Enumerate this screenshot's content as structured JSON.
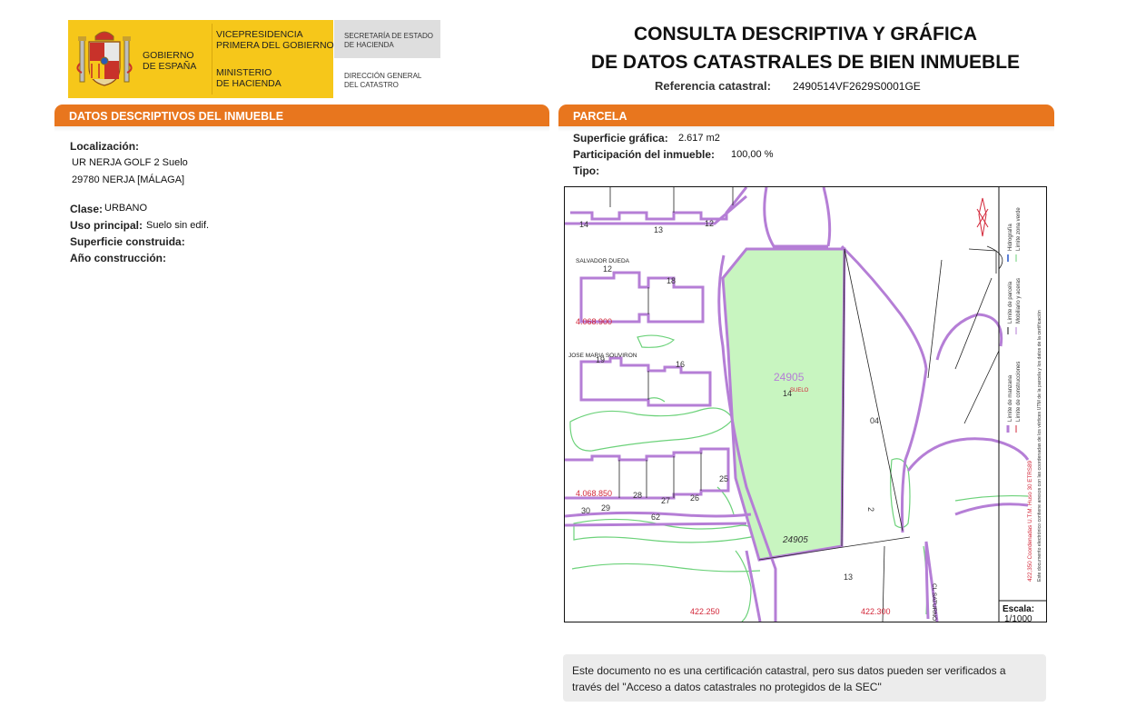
{
  "header": {
    "gobierno": [
      "GOBIERNO",
      "DE ESPAÑA"
    ],
    "vicepresidencia": [
      "VICEPRESIDENCIA",
      "PRIMERA DEL GOBIERNO"
    ],
    "ministerio": [
      "MINISTERIO",
      "DE HACIENDA"
    ],
    "secretaria": [
      "SECRETARÍA DE ESTADO",
      "DE HACIENDA"
    ],
    "direccion": [
      "DIRECCIÓN GENERAL",
      "DEL CATASTRO"
    ],
    "title_line1": "CONSULTA DESCRIPTIVA Y GRÁFICA",
    "title_line2": "DE DATOS CATASTRALES DE BIEN INMUEBLE",
    "refcat_label": "Referencia catastral:",
    "refcat_value": "2490514VF2629S0001GE",
    "colors": {
      "gov_yellow": "#f6c71a",
      "accent_orange": "#e8761e"
    }
  },
  "left_section": {
    "title": "DATOS DESCRIPTIVOS DEL INMUEBLE",
    "localizacion_label": "Localización:",
    "localizacion_line1": "UR NERJA GOLF 2 Suelo",
    "localizacion_line2": "29780 NERJA [MÁLAGA]",
    "clase_label": "Clase:",
    "clase_value": "URBANO",
    "uso_label": "Uso principal:",
    "uso_value": "Suelo sin edif.",
    "superficie_label": "Superficie construida:",
    "ano_label": "Año construcción:"
  },
  "right_section": {
    "title": "PARCELA",
    "superficie_label": "Superficie gráfica:",
    "superficie_value": "2.617 m2",
    "participacion_label": "Participación del inmueble:",
    "participacion_value": "100,00 %",
    "tipo_label": "Tipo:"
  },
  "map": {
    "parcel_id": "24905",
    "parcel_id_bottom": "24905",
    "parcel_number": "14",
    "suelo_label": "SUELO",
    "street1": "SALVADOR DUEDA",
    "street2": "JOSE MARIA SOUVIRON",
    "street3": "CL SATURNO",
    "coord_y1": "4.068.900",
    "coord_y2": "4.068.850",
    "coord_x1": "422.250",
    "coord_x2": "422.300",
    "numbers": {
      "n14a": "14",
      "n13a": "13",
      "n12a": "12",
      "n12b": "12",
      "n18": "18",
      "n19": "19",
      "n16": "16",
      "n04": "04",
      "n2": "2",
      "n25": "25",
      "n26": "26",
      "n27": "27",
      "n28": "28",
      "n30": "30",
      "n29": "29",
      "n62": "62",
      "n13b": "13"
    },
    "legend_items": [
      "Límite de manzana",
      "Límite de construcciones",
      "Límite de parcela",
      "Mobiliario y aceras",
      "Hidrografía",
      "Límite zona verde"
    ],
    "legend_coords": "422,350 Coordenadas U.T.M. Huso 30 ETRS89",
    "legend_note": "Este documento electrónico contiene anexos con las coordenadas de los vértices UTM de la parcela y los datos de la certificación",
    "scale_label": "Escala:",
    "scale_value": "1/1000",
    "colors": {
      "parcel_fill": "#c8f5c0",
      "purple_line": "#b57ed6",
      "green_line": "#6cd27a",
      "red_text": "#d3283a"
    }
  },
  "footer_note": {
    "line1": "Este documento no es una certificación catastral, pero sus datos pueden ser verificados a",
    "line2": "través del \"Acceso a datos catastrales no protegidos de la SEC\""
  }
}
